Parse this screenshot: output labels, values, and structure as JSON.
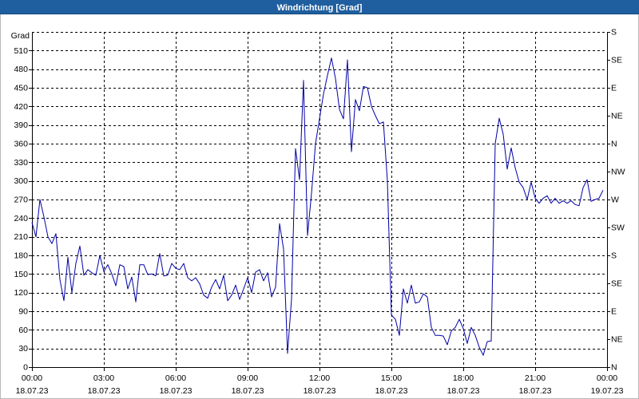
{
  "colors": {
    "title_bar": "#1f5f9f",
    "title_text": "#ffffff",
    "series_line": "#0000a8",
    "grid": "#000000",
    "plot_background": "#ffffff"
  },
  "chart_data": {
    "type": "line",
    "title": "Windrichtung [Grad]",
    "ylabel": "Grad",
    "ylim": [
      0,
      540
    ],
    "grid": true,
    "legend": false,
    "y_ticks": [
      0,
      30,
      60,
      90,
      120,
      150,
      180,
      210,
      240,
      270,
      300,
      330,
      360,
      390,
      420,
      450,
      480,
      510
    ],
    "y2_ticks": [
      {
        "value": 0,
        "label": "N"
      },
      {
        "value": 45,
        "label": "NE"
      },
      {
        "value": 90,
        "label": "E"
      },
      {
        "value": 135,
        "label": "SE"
      },
      {
        "value": 180,
        "label": "S"
      },
      {
        "value": 225,
        "label": "SW"
      },
      {
        "value": 270,
        "label": "W"
      },
      {
        "value": 315,
        "label": "NW"
      },
      {
        "value": 360,
        "label": "N"
      },
      {
        "value": 405,
        "label": "NE"
      },
      {
        "value": 450,
        "label": "E"
      },
      {
        "value": 495,
        "label": "SE"
      },
      {
        "value": 540,
        "label": "S"
      }
    ],
    "x_ticks": [
      {
        "time": "00:00",
        "date": "18.07.23"
      },
      {
        "time": "03:00",
        "date": "18.07.23"
      },
      {
        "time": "06:00",
        "date": "18.07.23"
      },
      {
        "time": "09:00",
        "date": "18.07.23"
      },
      {
        "time": "12:00",
        "date": "18.07.23"
      },
      {
        "time": "15:00",
        "date": "18.07.23"
      },
      {
        "time": "18:00",
        "date": "18.07.23"
      },
      {
        "time": "21:00",
        "date": "18.07.23"
      },
      {
        "time": "00:00",
        "date": "19.07.23"
      }
    ],
    "series": [
      {
        "x": [
          "00:00",
          "00:10",
          "00:20",
          "00:30",
          "00:40",
          "00:50",
          "01:00",
          "01:10",
          "01:20",
          "01:30",
          "01:40",
          "01:50",
          "02:00",
          "02:10",
          "02:20",
          "02:30",
          "02:40",
          "02:50",
          "03:00",
          "03:10",
          "03:20",
          "03:30",
          "03:40",
          "03:50",
          "04:00",
          "04:10",
          "04:20",
          "04:30",
          "04:40",
          "04:50",
          "05:00",
          "05:10",
          "05:20",
          "05:30",
          "05:40",
          "05:50",
          "06:00",
          "06:10",
          "06:20",
          "06:30",
          "06:40",
          "06:50",
          "07:00",
          "07:10",
          "07:20",
          "07:30",
          "07:40",
          "07:50",
          "08:00",
          "08:10",
          "08:20",
          "08:30",
          "08:40",
          "08:50",
          "09:00",
          "09:10",
          "09:20",
          "09:30",
          "09:40",
          "09:50",
          "10:00",
          "10:10",
          "10:20",
          "10:30",
          "10:40",
          "10:50",
          "11:00",
          "11:10",
          "11:20",
          "11:30",
          "11:40",
          "11:50",
          "12:00",
          "12:10",
          "12:20",
          "12:30",
          "12:40",
          "12:50",
          "13:00",
          "13:10",
          "13:20",
          "13:30",
          "13:40",
          "13:50",
          "14:00",
          "14:10",
          "14:20",
          "14:30",
          "14:40",
          "14:50",
          "15:00",
          "15:10",
          "15:20",
          "15:30",
          "15:40",
          "15:50",
          "16:00",
          "16:10",
          "16:20",
          "16:30",
          "16:40",
          "16:50",
          "17:00",
          "17:10",
          "17:20",
          "17:30",
          "17:40",
          "17:50",
          "18:00",
          "18:10",
          "18:20",
          "18:30",
          "18:40",
          "18:50",
          "19:00",
          "19:10",
          "19:20",
          "19:30",
          "19:40",
          "19:50",
          "20:00",
          "20:10",
          "20:20",
          "20:30",
          "20:40",
          "20:50",
          "21:00",
          "21:10",
          "21:20",
          "21:30",
          "21:40",
          "21:50",
          "22:00",
          "22:10",
          "22:20",
          "22:30",
          "22:40",
          "22:50",
          "23:00",
          "23:10",
          "23:20",
          "23:30",
          "23:40",
          "23:50"
        ],
        "values": [
          233,
          210,
          270,
          242,
          210,
          199,
          215,
          141,
          107,
          177,
          120,
          167,
          195,
          148,
          157,
          152,
          148,
          180,
          154,
          165,
          150,
          131,
          165,
          162,
          126,
          145,
          105,
          165,
          165,
          149,
          150,
          147,
          183,
          147,
          148,
          167,
          159,
          157,
          167,
          144,
          139,
          144,
          134,
          116,
          111,
          129,
          141,
          126,
          148,
          107,
          116,
          132,
          109,
          126,
          144,
          120,
          153,
          157,
          139,
          152,
          113,
          129,
          231,
          190,
          22,
          110,
          352,
          302,
          462,
          212,
          280,
          360,
          400,
          440,
          470,
          498,
          465,
          415,
          400,
          495,
          347,
          431,
          413,
          452,
          450,
          420,
          405,
          392,
          395,
          300,
          84,
          77,
          51,
          126,
          103,
          132,
          103,
          105,
          118,
          113,
          64,
          51,
          51,
          50,
          36,
          58,
          64,
          77,
          62,
          38,
          64,
          51,
          32,
          19,
          41,
          42,
          360,
          401,
          375,
          319,
          353,
          321,
          298,
          289,
          270,
          298,
          272,
          264,
          272,
          276,
          264,
          272,
          264,
          268,
          264,
          268,
          262,
          260,
          289,
          302,
          267,
          270,
          272,
          285
        ]
      }
    ]
  }
}
